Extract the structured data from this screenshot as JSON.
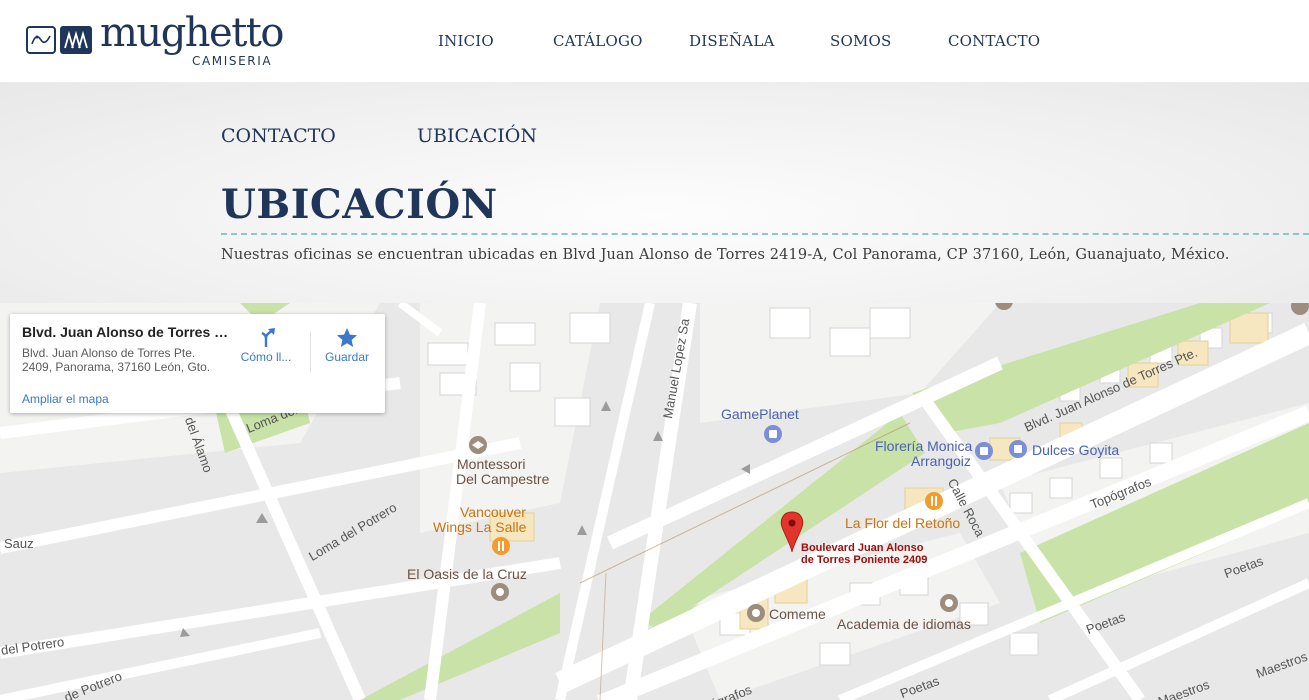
{
  "header": {
    "logo_word": "mughetto",
    "logo_sub": "CAMISERIA",
    "nav": [
      {
        "label": "INICIO"
      },
      {
        "label": "CATÁLOGO"
      },
      {
        "label": "DISEÑALA"
      },
      {
        "label": "SOMOS"
      },
      {
        "label": "CONTACTO"
      }
    ]
  },
  "subnav": [
    {
      "label": "CONTACTO"
    },
    {
      "label": "UBICACIÓN"
    }
  ],
  "page": {
    "title": "UBICACIÓN",
    "address": "Nuestras oficinas se encuentran ubicadas en Blvd Juan Alonso de Torres 2419-A, Col Panorama, CP 37160, León, Guanajuato, México."
  },
  "map": {
    "card": {
      "title": "Blvd. Juan Alonso de Torres P...",
      "address_line1": "Blvd. Juan Alonso de Torres Pte.",
      "address_line2": "2409, Panorama, 37160 León, Gto.",
      "directions_label": "Cómo ll...",
      "save_label": "Guardar",
      "enlarge_label": "Ampliar el mapa"
    },
    "streets": {
      "blvd": "Blvd. Juan Alonso de Torres Pte.",
      "manuel": "Manuel Lopez Sa",
      "loma_sauz": "Loma del Sauz",
      "alamo": "del Álamo",
      "loma_potrero": "Loma del Potrero",
      "sauz": "Sauz",
      "del_potrero": "del Potrero",
      "de_potrero": "de Potrero",
      "calle_roca": "Calle Roca",
      "topografos": "Topógrafos",
      "topografos2": "ógrafos",
      "poetas1": "Poetas",
      "poetas2": "Poetas",
      "poetas3": "Poetas",
      "maestros1": "Maestros",
      "maestros2": "Maestros"
    },
    "pois": {
      "gameplanet": "GamePlanet",
      "floreria_1": "Florería Monica",
      "floreria_2": "Arrangoiz",
      "dulces": "Dulces Goyita",
      "montessori_1": "Montessori",
      "montessori_2": "Del Campestre",
      "vancouver_1": "Vancouver",
      "vancouver_2": "Wings La Salle",
      "oasis": "El Oasis de la Cruz",
      "flor_reton": "La Flor del Retoño",
      "pin_1": "Boulevard Juan Alonso",
      "pin_2": "de Torres Poniente 2409",
      "comeme": "Comeme",
      "academia": "Academia de idiomas"
    },
    "colors": {
      "park": "#c8e2a7",
      "road": "#ffffff",
      "block": "#f5f5f3",
      "pin": "#e2352c"
    }
  }
}
